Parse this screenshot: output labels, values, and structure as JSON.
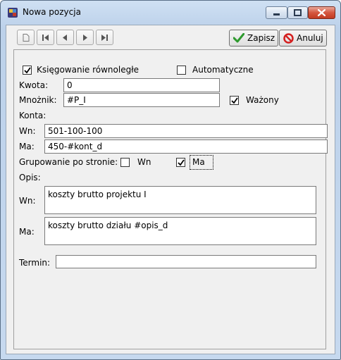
{
  "window": {
    "title": "Nowa pozycja"
  },
  "toolbar": {
    "save_label": "Zapisz",
    "cancel_label": "Anuluj"
  },
  "form": {
    "rownolegle_label": "Księgowanie równoległe",
    "rownolegle_checked": true,
    "automatyczne_label": "Automatyczne",
    "automatyczne_checked": false,
    "kwota_label": "Kwota:",
    "kwota_value": "0",
    "mnoznik_label": "Mnożnik:",
    "mnoznik_value": "#P_I",
    "wazony_label": "Ważony",
    "wazony_checked": true,
    "konta_label": "Konta:",
    "wn_label": "Wn:",
    "wn_value": "501-100-100",
    "ma_label": "Ma:",
    "ma_value": "450-#kont_d",
    "grupowanie_label": "Grupowanie po stronie:",
    "grup_wn_label": "Wn",
    "grup_wn_checked": false,
    "grup_ma_label": "Ma",
    "grup_ma_checked": true,
    "opis_label": "Opis:",
    "opis_wn_label": "Wn:",
    "opis_wn_value": "koszty brutto projektu I",
    "opis_ma_label": "Ma:",
    "opis_ma_value": "koszty brutto działu #opis_d",
    "termin_label": "Termin:",
    "termin_value": ""
  },
  "colors": {
    "titlebar": "#c6d9ef",
    "close_button": "#c23b22",
    "save_check": "#2e9a2e",
    "cancel_icon": "#d42020"
  }
}
